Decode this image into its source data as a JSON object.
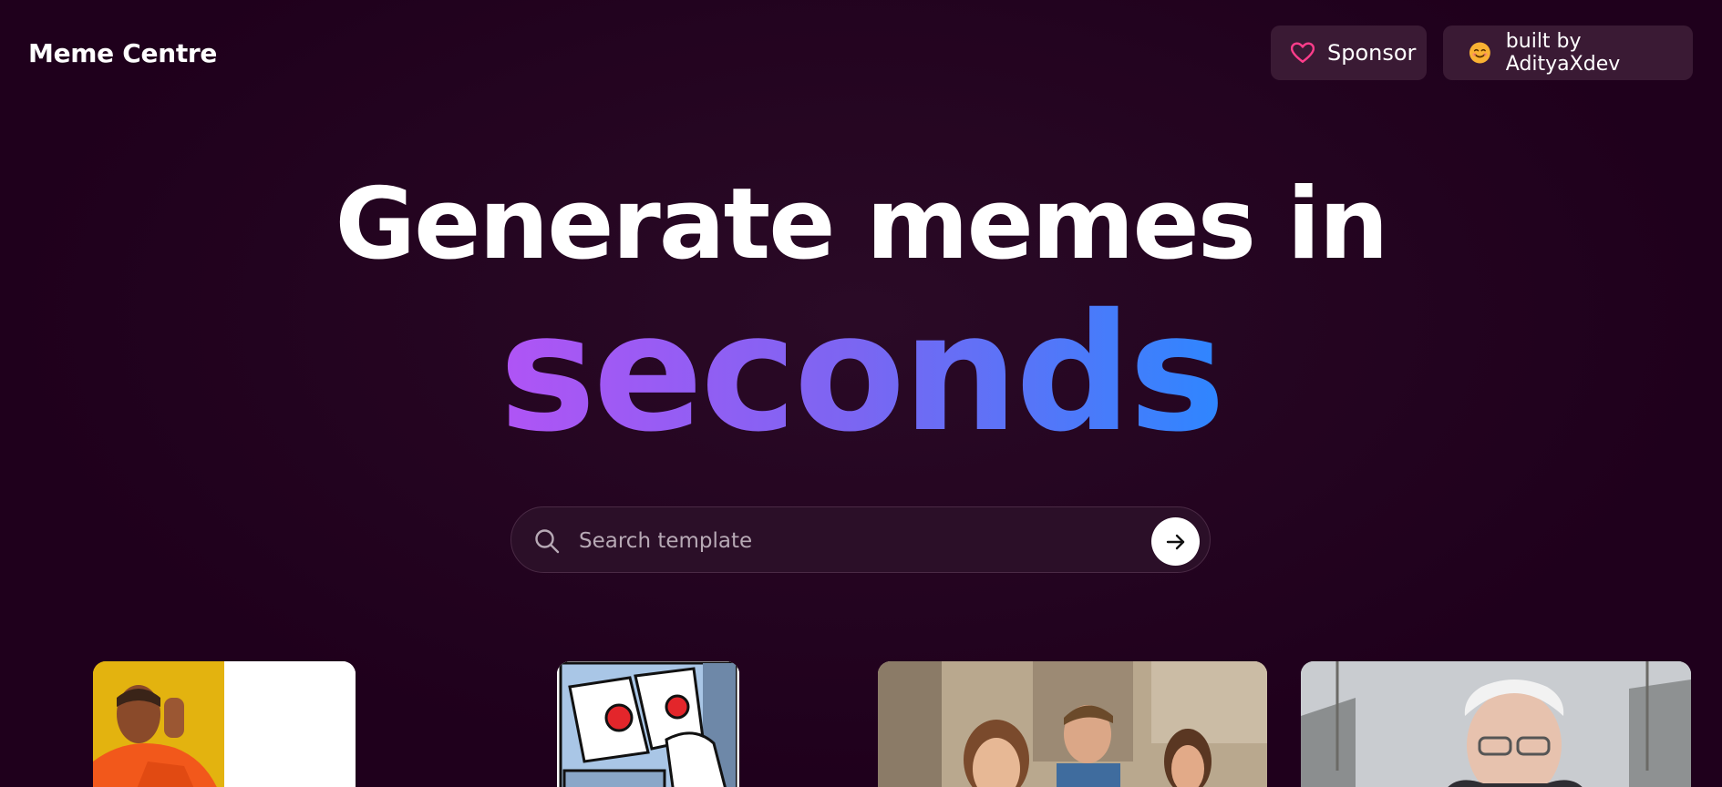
{
  "header": {
    "brand": "Meme Centre",
    "sponsor_label": "Sponsor",
    "built_by_label": "built by AdityaXdev",
    "sponsor_icon": "heart-icon",
    "built_by_icon": "smiling-face-emoji-icon"
  },
  "hero": {
    "line1": "Generate memes in",
    "line2": "seconds",
    "gradient_colors": [
      "#b054f5",
      "#2e86ff"
    ]
  },
  "search": {
    "placeholder": "Search template",
    "value": "",
    "submit_icon": "arrow-right-icon"
  },
  "templates": [
    {
      "name": "drake-hotline-bling"
    },
    {
      "name": "two-buttons"
    },
    {
      "name": "distracted-boyfriend"
    },
    {
      "name": "bernie-asking-for-support"
    }
  ],
  "colors": {
    "background": "#21001e",
    "button_bg": "#3a1a34",
    "heart": "#ff3d8b"
  }
}
